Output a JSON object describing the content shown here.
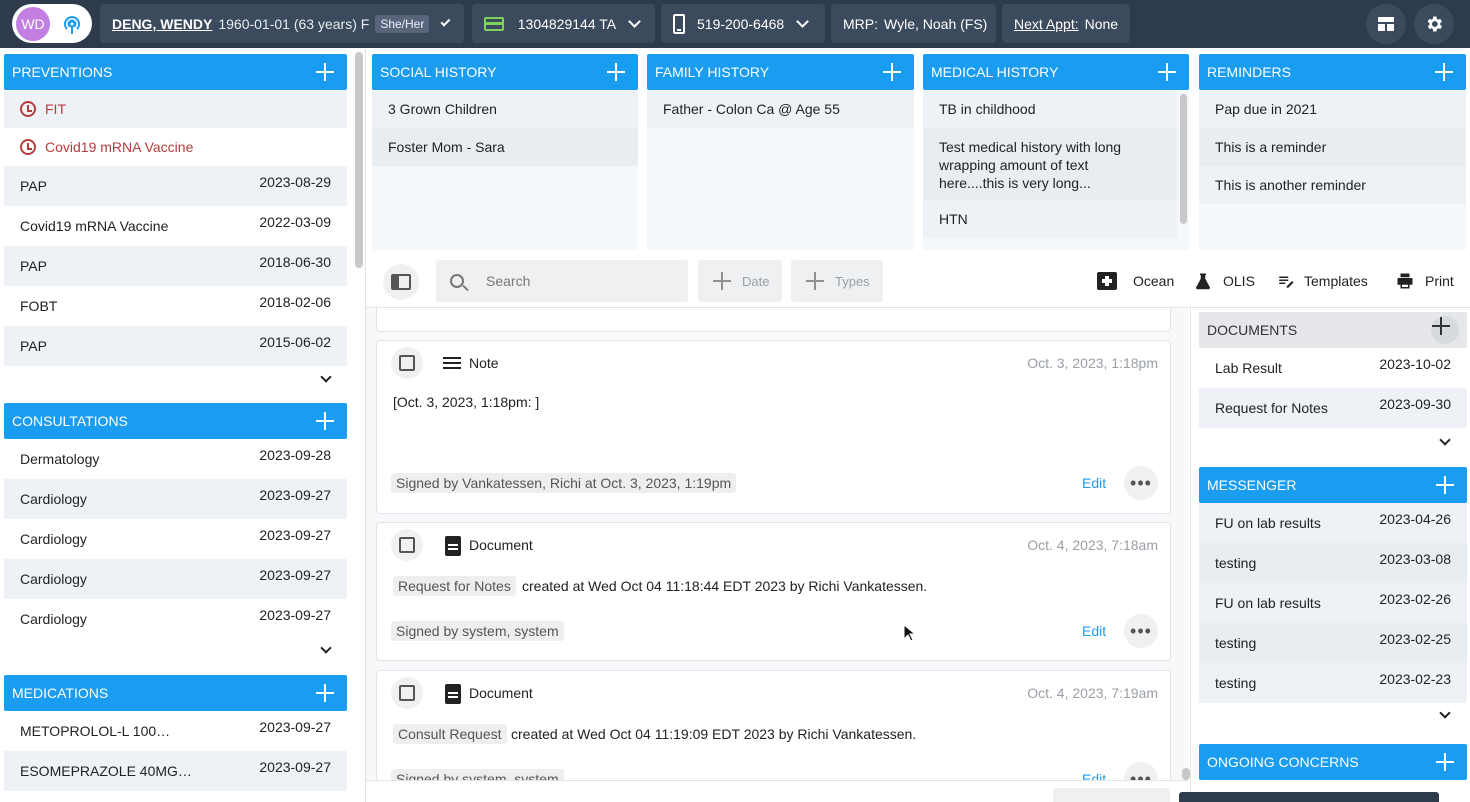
{
  "header": {
    "avatar_initials": "WD",
    "patient_name": "DENG, WENDY",
    "dob_age_sex": "1960-01-01 (63 years)  F",
    "pronouns": "She/Her",
    "health_card": "1304829144 TA",
    "phone": "519-200-6468",
    "mrp_label": "MRP:",
    "mrp_value": "Wyle, Noah  (FS)",
    "next_appt_label": "Next Appt:",
    "next_appt_value": "None"
  },
  "preventions": {
    "title": "PREVENTIONS",
    "due": [
      {
        "label": "FIT"
      },
      {
        "label": "Covid19 mRNA Vaccine"
      }
    ],
    "items": [
      {
        "label": "PAP",
        "date": "2023-08-29"
      },
      {
        "label": "Covid19 mRNA Vaccine",
        "date": "2022-03-09"
      },
      {
        "label": "PAP",
        "date": "2018-06-30"
      },
      {
        "label": "FOBT",
        "date": "2018-02-06"
      },
      {
        "label": "PAP",
        "date": "2015-06-02"
      }
    ]
  },
  "consultations": {
    "title": "CONSULTATIONS",
    "items": [
      {
        "label": "Dermatology",
        "date": "2023-09-28"
      },
      {
        "label": "Cardiology",
        "date": "2023-09-27"
      },
      {
        "label": "Cardiology",
        "date": "2023-09-27"
      },
      {
        "label": "Cardiology",
        "date": "2023-09-27"
      },
      {
        "label": "Cardiology",
        "date": "2023-09-27"
      }
    ]
  },
  "medications": {
    "title": "MEDICATIONS",
    "items": [
      {
        "label": "METOPROLOL-L 100…",
        "date": "2023-09-27"
      },
      {
        "label": "ESOMEPRAZOLE 40MG…",
        "date": "2023-09-27"
      }
    ]
  },
  "social_history": {
    "title": "SOCIAL HISTORY",
    "items": [
      "3 Grown Children",
      "Foster Mom - Sara"
    ]
  },
  "family_history": {
    "title": "FAMILY HISTORY",
    "items": [
      "Father - Colon Ca @ Age 55"
    ]
  },
  "medical_history": {
    "title": "MEDICAL HISTORY",
    "items": [
      "TB in childhood",
      "Test medical history with long wrapping amount of text here....this is very long...",
      "HTN"
    ]
  },
  "reminders": {
    "title": "REMINDERS",
    "items": [
      "Pap due in 2021",
      "This is a reminder",
      "This is another reminder"
    ]
  },
  "toolbar": {
    "search_placeholder": "Search",
    "date_label": "Date",
    "types_label": "Types",
    "ocean_label": "Ocean",
    "olis_label": "OLIS",
    "templates_label": "Templates",
    "print_label": "Print"
  },
  "notes": [
    {
      "type": "Note",
      "date": "Oct. 3, 2023, 1:18pm",
      "body": "[Oct. 3, 2023, 1:18pm: ]",
      "signed": "Signed by Vankatessen, Richi at Oct. 3, 2023, 1:19pm",
      "edit": "Edit"
    },
    {
      "type": "Document",
      "date": "Oct. 4, 2023, 7:18am",
      "tag": "Request for Notes",
      "body": "created at Wed Oct 04 11:18:44 EDT 2023 by Richi Vankatessen.",
      "signed": "Signed by system, system",
      "edit": "Edit"
    },
    {
      "type": "Document",
      "date": "Oct. 4, 2023, 7:19am",
      "tag": "Consult Request",
      "body": "created at Wed Oct 04 11:19:09 EDT 2023 by Richi Vankatessen.",
      "signed": "Signed by system, system",
      "edit": "Edit"
    }
  ],
  "documents": {
    "title": "DOCUMENTS",
    "items": [
      {
        "label": "Lab Result",
        "date": "2023-10-02"
      },
      {
        "label": "Request for Notes",
        "date": "2023-09-30"
      }
    ]
  },
  "messenger": {
    "title": "MESSENGER",
    "items": [
      {
        "label": "FU on lab results",
        "date": "2023-04-26"
      },
      {
        "label": "testing",
        "date": "2023-03-08"
      },
      {
        "label": "FU on lab results",
        "date": "2023-02-26"
      },
      {
        "label": "testing",
        "date": "2023-02-25"
      },
      {
        "label": "testing",
        "date": "2023-02-23"
      }
    ]
  },
  "ongoing_concerns": {
    "title": "ONGOING CONCERNS"
  },
  "colors": {
    "accent": "#1a9cf0",
    "header_bg": "#2d3b4d",
    "alert": "#b83c3c"
  }
}
